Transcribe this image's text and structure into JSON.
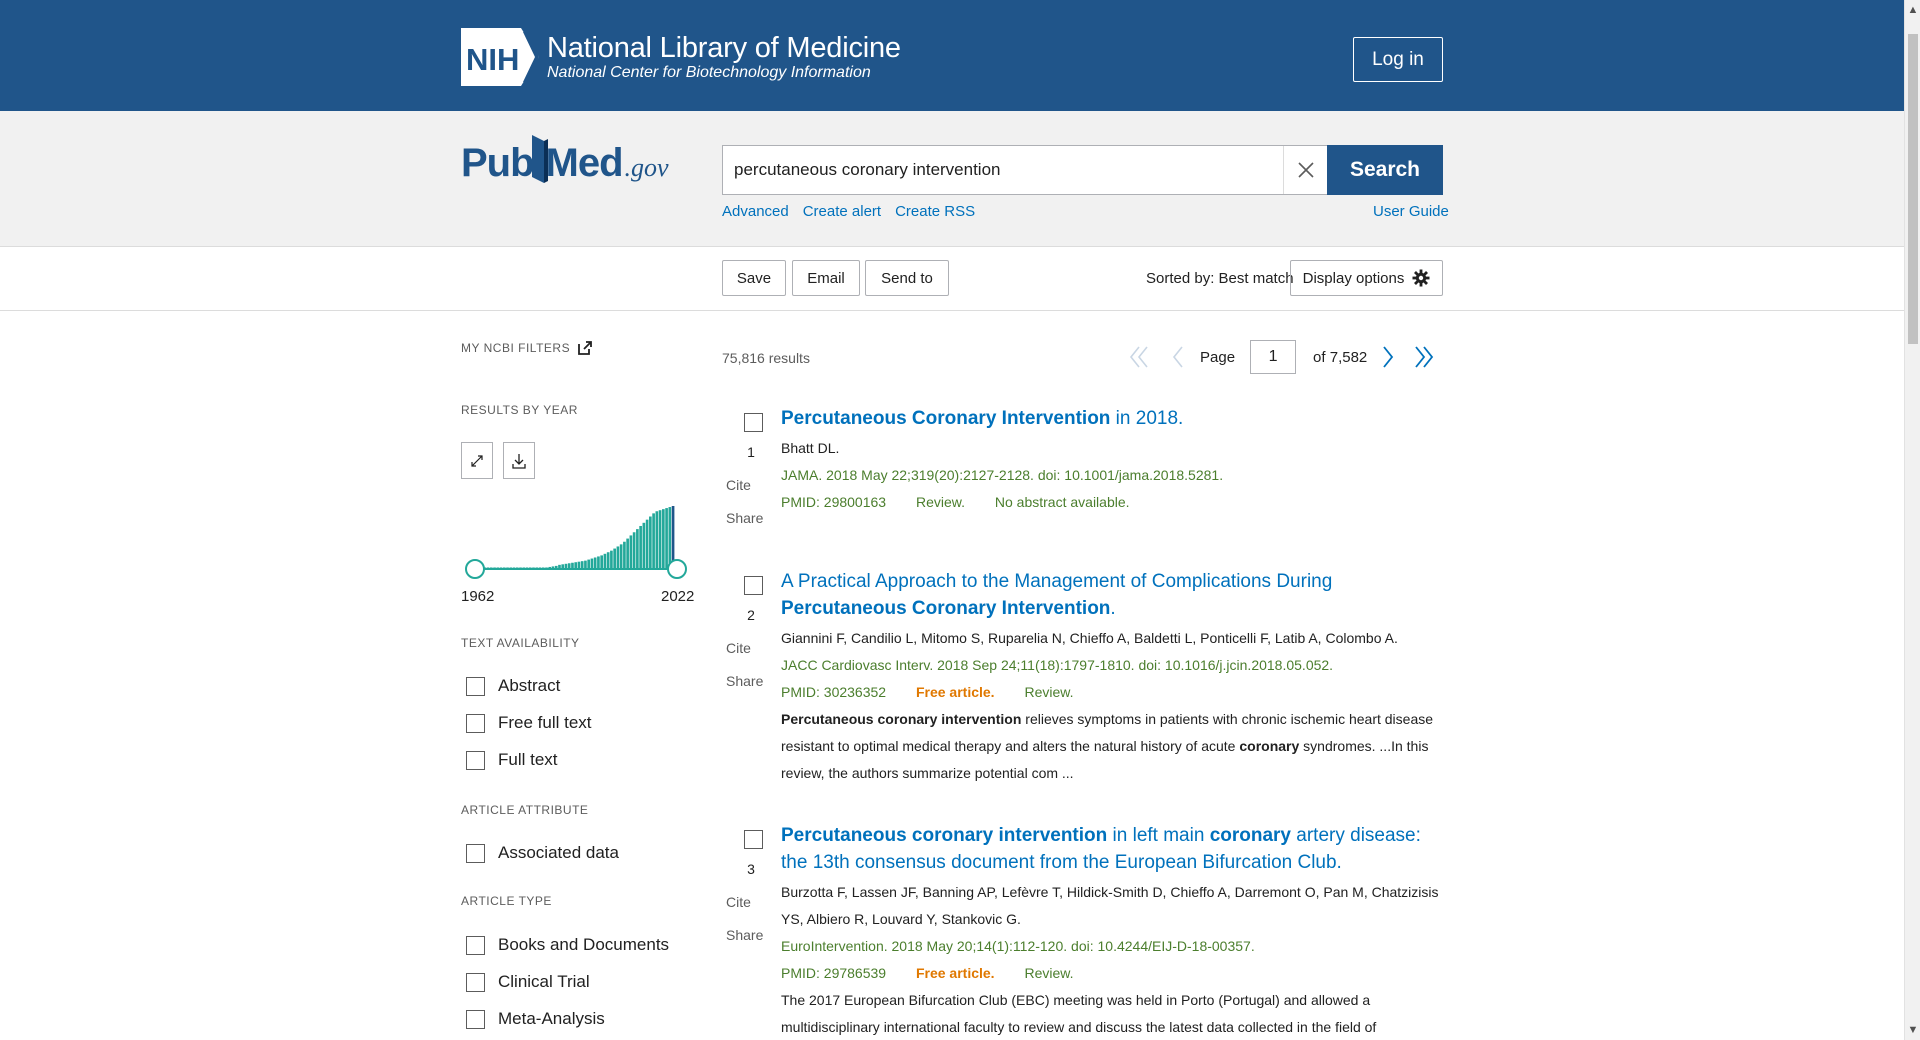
{
  "header": {
    "nih_badge": "NIH",
    "title": "National Library of Medicine",
    "subtitle": "National Center for Biotechnology Information",
    "login_label": "Log in"
  },
  "search": {
    "logo_pub": "Pub",
    "logo_med": "Med",
    "logo_gov": ".gov",
    "query": "percutaneous coronary intervention",
    "button_label": "Search",
    "links": [
      "Advanced",
      "Create alert",
      "Create RSS"
    ],
    "user_guide": "User Guide"
  },
  "toolbar": {
    "save": "Save",
    "email": "Email",
    "send_to": "Send to",
    "sorted_by": "Sorted by: Best match",
    "display_options": "Display options"
  },
  "sidebar": {
    "my_filters": "MY NCBI FILTERS",
    "results_by_year": "RESULTS BY YEAR",
    "year_start": "1962",
    "year_end": "2022",
    "text_availability": "TEXT AVAILABILITY",
    "text_filters": [
      "Abstract",
      "Free full text",
      "Full text"
    ],
    "article_attribute": "ARTICLE ATTRIBUTE",
    "attribute_filters": [
      "Associated data"
    ],
    "article_type": "ARTICLE TYPE",
    "type_filters": [
      "Books and Documents",
      "Clinical Trial",
      "Meta-Analysis"
    ],
    "histogram_values": [
      1,
      1,
      1,
      1,
      1,
      1,
      1,
      1,
      1,
      1,
      1,
      1,
      1,
      1,
      1,
      1,
      1,
      1,
      1,
      1,
      1,
      1,
      2,
      3,
      4,
      6,
      7,
      8,
      9,
      10,
      11,
      12,
      13,
      14,
      16,
      18,
      20,
      22,
      24,
      27,
      30,
      33,
      37,
      41,
      45,
      50,
      56,
      62,
      68,
      74,
      80,
      86,
      92,
      98,
      104,
      108,
      110,
      112,
      114,
      116,
      118
    ]
  },
  "results": {
    "count": "75,816 results",
    "page_label": "Page",
    "page_value": "1",
    "page_total": "of 7,582",
    "cite": "Cite",
    "share": "Share",
    "items": [
      {
        "num": "1",
        "title_bold": "Percutaneous Coronary Intervention",
        "title_rest": " in 2018.",
        "authors": "Bhatt DL.",
        "journal": "JAMA. 2018 May 22;319(20):2127-2128. doi: 10.1001/jama.2018.5281.",
        "pmid": "PMID: 29800163",
        "type": "Review.",
        "note": "No abstract available."
      },
      {
        "num": "2",
        "title_pre": "A Practical Approach to the Management of Complications During ",
        "title_bold": "Percutaneous Coronary Intervention",
        "title_rest": ".",
        "authors": "Giannini F, Candilio L, Mitomo S, Ruparelia N, Chieffo A, Baldetti L, Ponticelli F, Latib A, Colombo A.",
        "journal": "JACC Cardiovasc Interv. 2018 Sep 24;11(18):1797-1810. doi: 10.1016/j.jcin.2018.05.052.",
        "pmid": "PMID: 30236352",
        "free": "Free article.",
        "type": "Review.",
        "snip_b1": "Percutaneous coronary intervention",
        "snip_1": " relieves symptoms in patients with chronic ischemic heart disease resistant to optimal medical therapy and alters the natural history of acute ",
        "snip_b2": "coronary",
        "snip_2": " syndromes. ...In this review, the authors summarize potential com ..."
      },
      {
        "num": "3",
        "title_bold": "Percutaneous coronary intervention",
        "title_mid": " in left main ",
        "title_bold2": "coronary",
        "title_rest": " artery disease: the 13th consensus document from the European Bifurcation Club.",
        "authors": "Burzotta F, Lassen JF, Banning AP, Lefèvre T, Hildick-Smith D, Chieffo A, Darremont O, Pan M, Chatzizisis YS, Albiero R, Louvard Y, Stankovic G.",
        "journal": "EuroIntervention. 2018 May 20;14(1):112-120. doi: 10.4244/EIJ-D-18-00357.",
        "pmid": "PMID: 29786539",
        "free": "Free article.",
        "type": "Review.",
        "snippet": "The 2017 European Bifurcation Club (EBC) meeting was held in Porto (Portugal) and allowed a multidisciplinary international faculty to review and discuss the latest data collected in the field of"
      }
    ]
  }
}
